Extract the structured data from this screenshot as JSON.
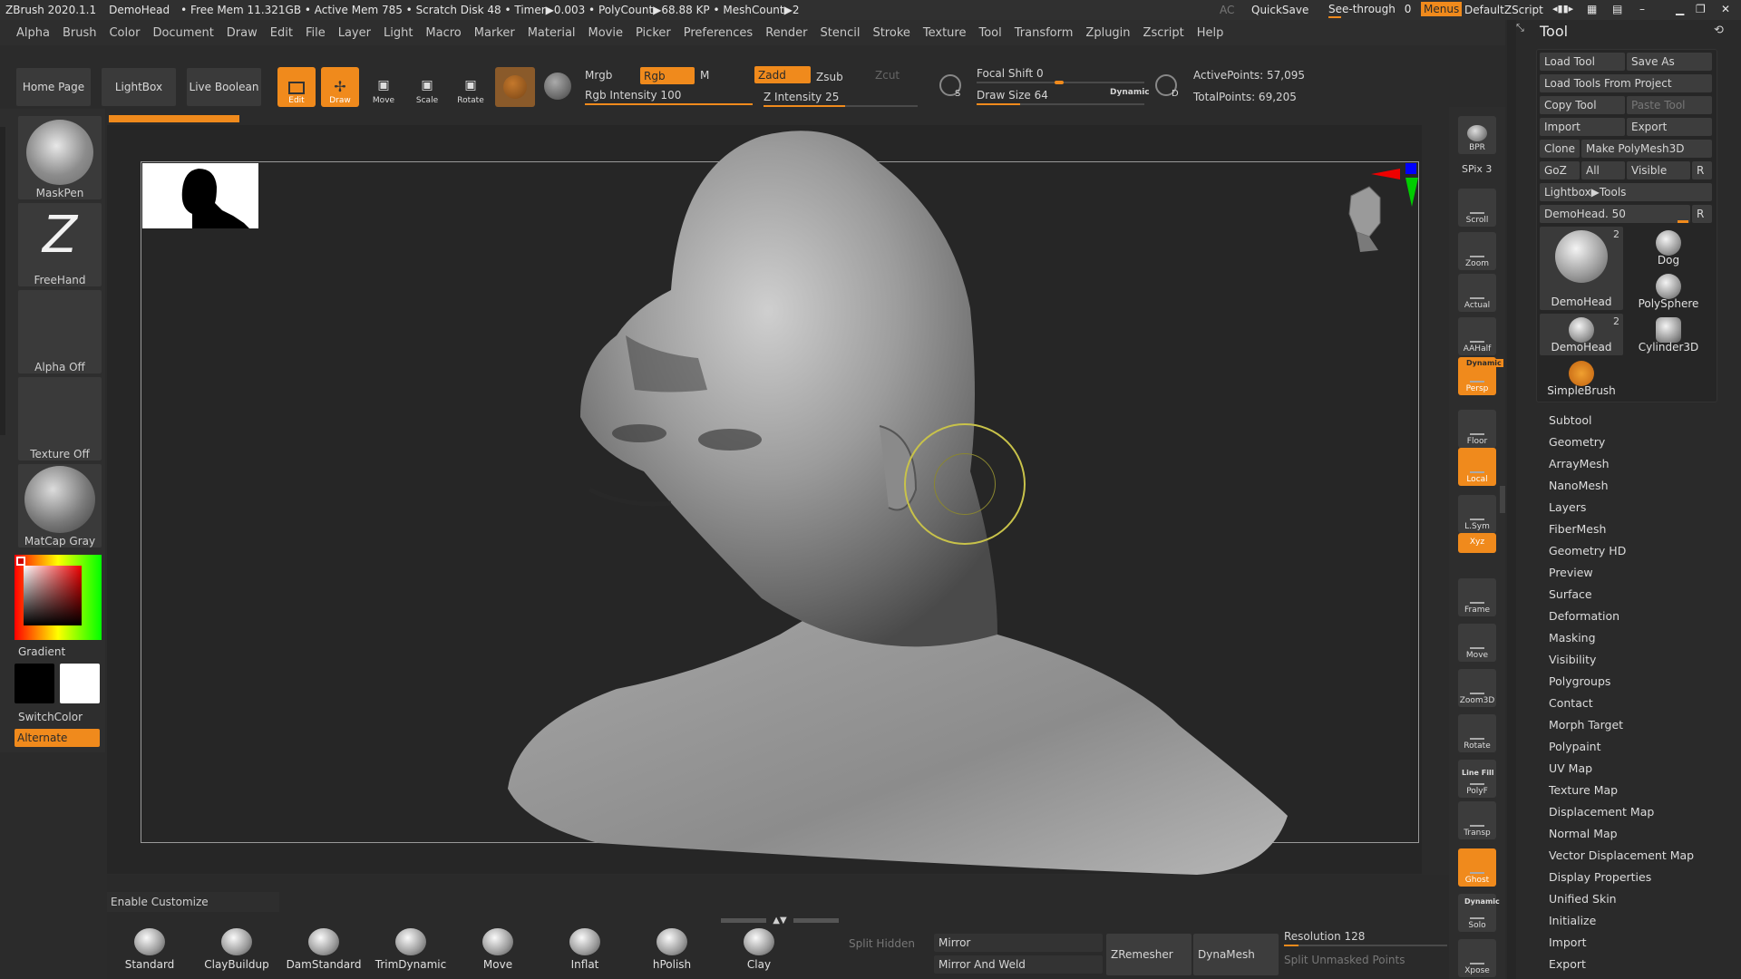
{
  "titlebar": {
    "app": "ZBrush 2020.1.1",
    "doc": "DemoHead",
    "stats": "• Free Mem 11.321GB • Active Mem 785 • Scratch Disk 48 • Timer▶0.003 • PolyCount▶68.88 KP • MeshCount▶2",
    "ac": "AC",
    "quicksave": "QuickSave",
    "seethrough": "See-through",
    "seethrough_val": "0",
    "menus": "Menus",
    "script": "DefaultZScript"
  },
  "menu": [
    "Alpha",
    "Brush",
    "Color",
    "Document",
    "Draw",
    "Edit",
    "File",
    "Layer",
    "Light",
    "Macro",
    "Marker",
    "Material",
    "Movie",
    "Picker",
    "Preferences",
    "Render",
    "Stencil",
    "Stroke",
    "Texture",
    "Tool",
    "Transform",
    "Zplugin",
    "Zscript",
    "Help"
  ],
  "shelf": {
    "home": "Home Page",
    "lightbox": "LightBox",
    "liveboolean": "Live Boolean",
    "edit": "Edit",
    "draw": "Draw",
    "move": "Move",
    "scale": "Scale",
    "rotate": "Rotate",
    "mrgb": "Mrgb",
    "rgb": "Rgb",
    "m": "M",
    "rgb_intensity": "Rgb Intensity 100",
    "zadd": "Zadd",
    "zsub": "Zsub",
    "zcut": "Zcut",
    "z_intensity": "Z Intensity 25",
    "focal_shift": "Focal Shift 0",
    "draw_size": "Draw Size 64",
    "dynamic": "Dynamic",
    "active_points": "ActivePoints: 57,095",
    "total_points": "TotalPoints: 69,205"
  },
  "left": {
    "brush": "MaskPen",
    "stroke": "FreeHand",
    "alpha": "Alpha Off",
    "texture": "Texture Off",
    "material": "MatCap Gray",
    "gradient": "Gradient",
    "switchcolor": "SwitchColor",
    "alternate": "Alternate"
  },
  "rightshelf": [
    "BPR",
    "SPix 3",
    "Scroll",
    "Zoom",
    "Actual",
    "AAHalf",
    "Persp",
    "Floor",
    "Local",
    "L.Sym",
    "Xyz",
    "Frame",
    "Move",
    "Zoom3D",
    "Rotate",
    "PolyF",
    "Transp",
    "Ghost",
    "Solo",
    "Xpose"
  ],
  "rightshelf_extra": {
    "dynamic": "Dynamic",
    "linefill": "Line Fill"
  },
  "tool": {
    "title": "Tool",
    "load": "Load Tool",
    "saveas": "Save As",
    "loadproject": "Load Tools From Project",
    "copy": "Copy Tool",
    "paste": "Paste Tool",
    "import": "Import",
    "export": "Export",
    "clone": "Clone",
    "makepoly": "Make PolyMesh3D",
    "goz": "GoZ",
    "all": "All",
    "visible": "Visible",
    "r": "R",
    "lightbox": "Lightbox▶Tools",
    "demohead_slider": "DemoHead. 50",
    "thumbs": [
      {
        "name": "DemoHead",
        "count": "2"
      },
      {
        "name": "Dog",
        "count": ""
      },
      {
        "name": "PolySphere",
        "count": ""
      },
      {
        "name": "DemoHead",
        "count": "2"
      },
      {
        "name": "Cylinder3D",
        "count": ""
      },
      {
        "name": "SimpleBrush",
        "count": ""
      }
    ],
    "sections": [
      "Subtool",
      "Geometry",
      "ArrayMesh",
      "NanoMesh",
      "Layers",
      "FiberMesh",
      "Geometry HD",
      "Preview",
      "Surface",
      "Deformation",
      "Masking",
      "Visibility",
      "Polygroups",
      "Contact",
      "Morph Target",
      "Polypaint",
      "UV Map",
      "Texture Map",
      "Displacement Map",
      "Normal Map",
      "Vector Displacement Map",
      "Display Properties",
      "Unified Skin",
      "Initialize",
      "Import",
      "Export"
    ]
  },
  "bottom": {
    "enable_customize": "Enable Customize",
    "brushes": [
      "Standard",
      "ClayBuildup",
      "DamStandard",
      "TrimDynamic",
      "Move",
      "Inflat",
      "hPolish",
      "Clay"
    ],
    "split_hidden": "Split Hidden",
    "mirror": "Mirror",
    "mirror_weld": "Mirror And Weld",
    "zremesher": "ZRemesher",
    "dynamesh": "DynaMesh",
    "resolution": "Resolution 128",
    "split_unmasked": "Split Unmasked Points"
  }
}
